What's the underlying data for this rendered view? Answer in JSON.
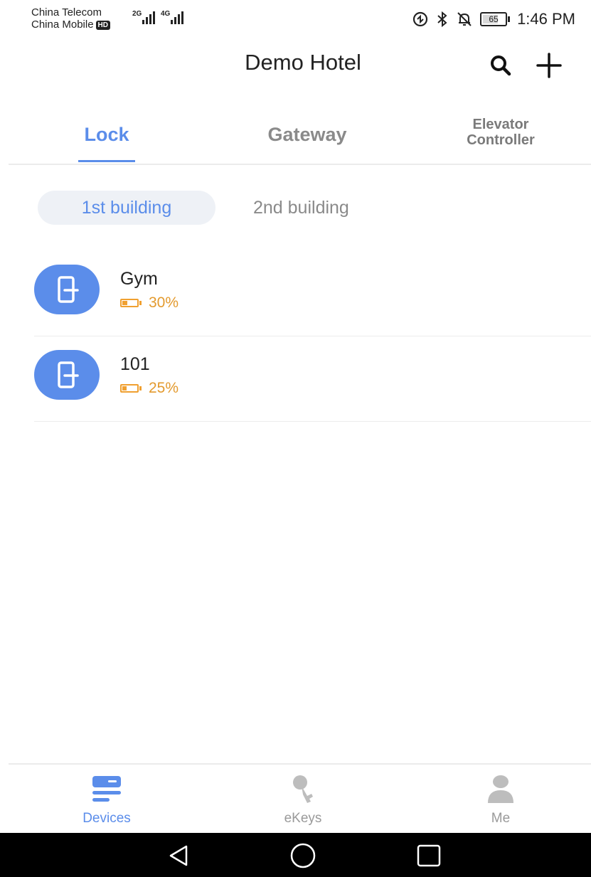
{
  "status_bar": {
    "carrier_1": "China Telecom",
    "carrier_2": "China Mobile",
    "hd_badge": "HD",
    "network_1": "2G",
    "network_2": "4G",
    "battery_level": "65",
    "time": "1:46 PM"
  },
  "header": {
    "title": "Demo Hotel",
    "search_icon": "search-icon",
    "add_icon": "plus-icon"
  },
  "device_tabs": {
    "lock": "Lock",
    "gateway": "Gateway",
    "elevator_line1": "Elevator",
    "elevator_line2": "Controller",
    "active": "Lock"
  },
  "buildings": {
    "first": "1st building",
    "second": "2nd building",
    "active": "1st building"
  },
  "devices": [
    {
      "name": "Gym",
      "battery": "30%",
      "battery_fraction": 0.3
    },
    {
      "name": "101",
      "battery": "25%",
      "battery_fraction": 0.25
    }
  ],
  "bottom_nav": {
    "devices": "Devices",
    "ekeys": "eKeys",
    "me": "Me",
    "active": "Devices"
  },
  "colors": {
    "accent": "#5b8dea",
    "battery": "#f0a030",
    "inactive": "#9a9a9a"
  }
}
